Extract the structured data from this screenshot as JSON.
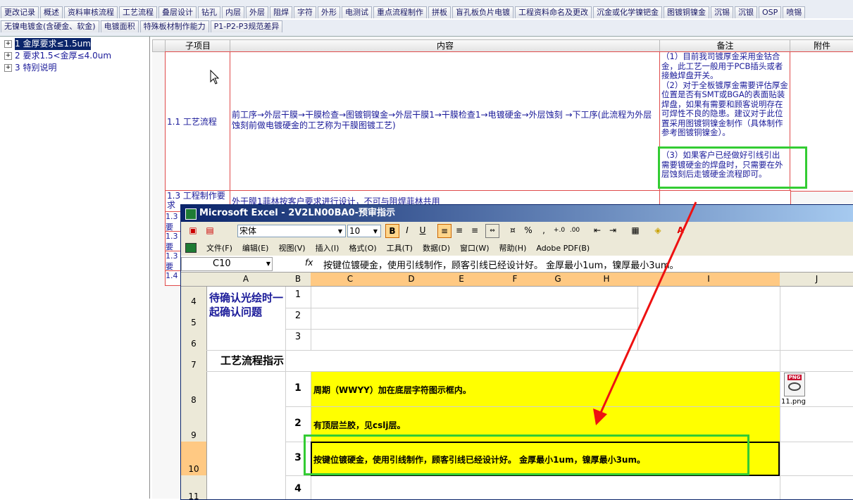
{
  "tabs_row1": [
    "更改记录",
    "概述",
    "资料审核流程",
    "工艺流程",
    "叠层设计",
    "钻孔",
    "内层",
    "外层",
    "阻焊",
    "字符",
    "外形",
    "电测试",
    "重点流程制作",
    "拼板",
    "盲孔板负片电镀",
    "工程资料命名及更改",
    "沉金或化学镍钯金",
    "图镀铜镍金",
    "沉锡",
    "沉银",
    "OSP",
    "喷锡"
  ],
  "tabs_row2": [
    "无镍电镀金(含硬金、软金)",
    "电镀面积",
    "特殊板材制作能力",
    "P1-P2-P3规范差异"
  ],
  "tree": {
    "items": [
      {
        "label": "1 金厚要求≤1.5um",
        "selected": true
      },
      {
        "label": "2 要求1.5<金厚≤4.0um",
        "selected": false
      },
      {
        "label": "3 特别说明",
        "selected": false
      }
    ]
  },
  "grid": {
    "headers": {
      "sub": "子项目",
      "content": "内容",
      "note": "备注",
      "attach": "附件"
    },
    "row1": {
      "sub": "1.1 工艺流程",
      "content": "前工序→外层干膜→干膜检查→图镀铜镍金→外层干膜1→干膜检查1→电镀硬金→外层蚀刻 →下工序(此流程为外层蚀刻前做电镀硬金的工艺称为干膜图镀工艺)",
      "note1": "（1）目前我司镀厚金采用金钴合金，此工艺一般用于PCB插头或者接触焊盘开关。",
      "note2": "（2）对于全板镀厚金需要评估厚金位置是否有SMT或BGA的表面贴装焊盘，如果有需要和顾客说明存在可焊性不良的隐患。建议对于此位置采用图镀铜镍金制作（具体制作参考图镀铜镍金）。",
      "note3": "（3）如果客户已经做好引线引出需要镀硬金的焊盘时，只需要在外层蚀刻后走镀硬金流程即可。"
    },
    "row2": {
      "sub": "1.3 工程制作要求",
      "content": "外干膜1菲林按客户要求进行设计，不可与阻焊菲林共用"
    },
    "rownums": [
      "1.3 要",
      "1.3 要",
      "1.3 要",
      "1.4"
    ]
  },
  "excel": {
    "title": "Microsoft Excel - 2V2LN00BA0-预审指示",
    "font_name": "宋体",
    "font_size": "10",
    "menu": [
      "文件(F)",
      "编辑(E)",
      "视图(V)",
      "插入(I)",
      "格式(O)",
      "工具(T)",
      "数据(D)",
      "窗口(W)",
      "帮助(H)",
      "Adobe PDF(B)"
    ],
    "cell_ref": "C10",
    "fx": "fx",
    "formula": "按键位镀硬金，使用引线制作，顾客引线已经设计好。 金厚最小1um，镍厚最小3um。",
    "columns": [
      "A",
      "B",
      "C",
      "D",
      "E",
      "F",
      "G",
      "H",
      "I",
      "J"
    ],
    "rows": [
      "4",
      "5",
      "6",
      "7",
      "8",
      "9",
      "10",
      "11"
    ],
    "a_confirm": "待确认光绘时一起确认问题",
    "b_nums": [
      "1",
      "2",
      "3"
    ],
    "flow_title": "工艺流程指示",
    "items": [
      {
        "num": "1",
        "text": "周期（WWYY）加在底层字符图示框内。"
      },
      {
        "num": "2",
        "text": "有顶层兰胶，见cslj层。"
      },
      {
        "num": "3",
        "text": "按键位镀硬金，使用引线制作，顾客引线已经设计好。 金厚最小1um，镍厚最小3um。"
      },
      {
        "num": "4",
        "text": ""
      }
    ],
    "attachment": {
      "badge": "PNG",
      "name": "11.png"
    }
  },
  "colors": {
    "highlight_green": "#33cc33",
    "arrow_red": "#ee1111",
    "cell_yellow": "#ffff00",
    "title_blue": "#0a246a"
  }
}
